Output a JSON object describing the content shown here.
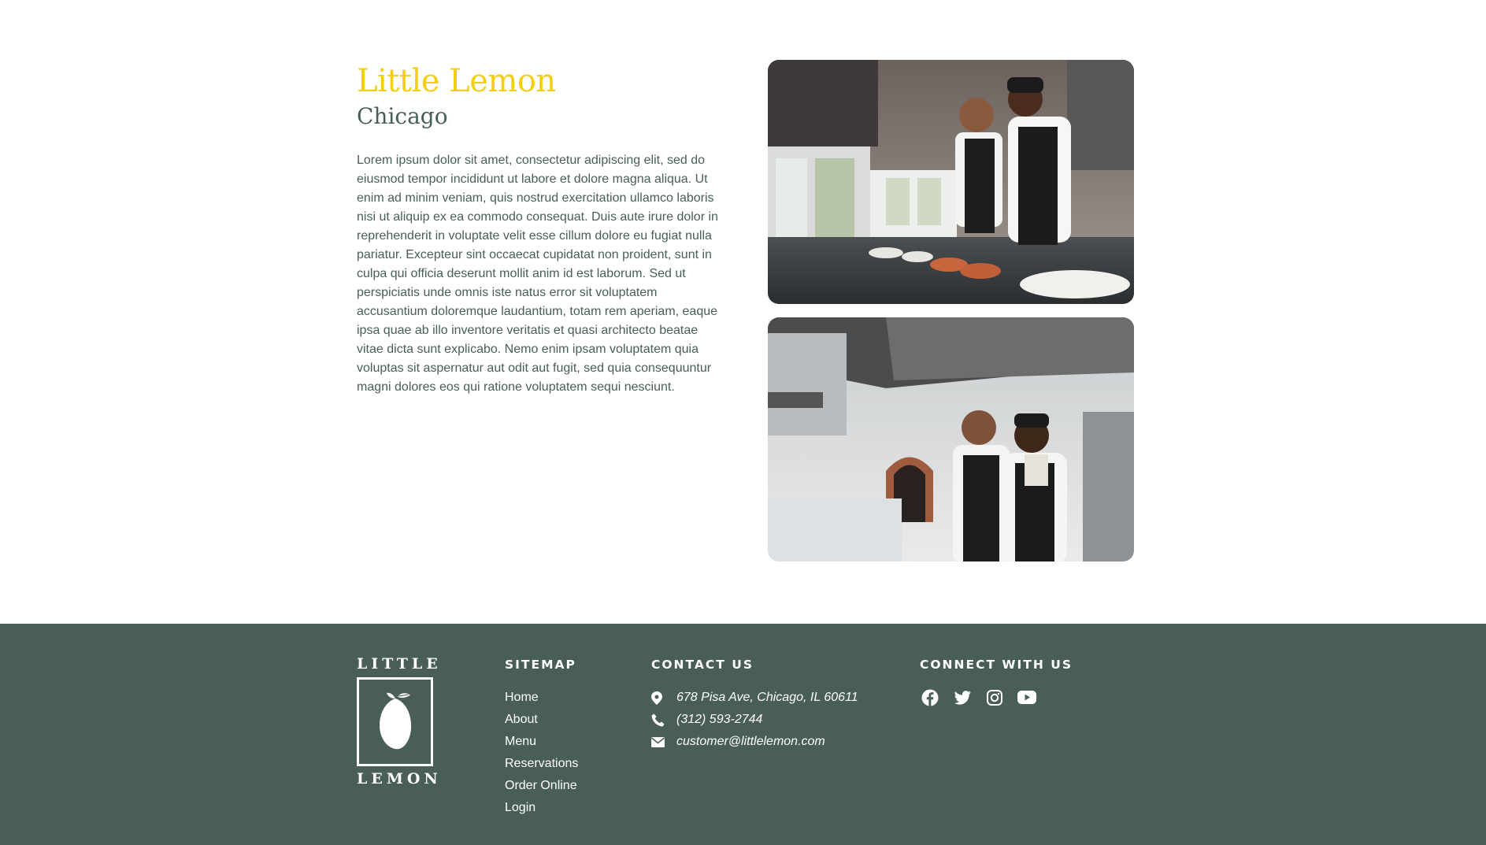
{
  "about": {
    "title": "Little Lemon",
    "subtitle": "Chicago",
    "description": "Lorem ipsum dolor sit amet, consectetur adipiscing elit, sed do eiusmod tempor incididunt ut labore et dolore magna aliqua. Ut enim ad minim veniam, quis nostrud exercitation ullamco laboris nisi ut aliquip ex ea commodo consequat. Duis aute irure dolor in reprehenderit in voluptate velit esse cillum dolore eu fugiat nulla pariatur. Excepteur sint occaecat cupidatat non proident, sunt in culpa qui officia deserunt mollit anim id est laborum. Sed ut perspiciatis unde omnis iste natus error sit voluptatem accusantium doloremque laudantium, totam rem aperiam, eaque ipsa quae ab illo inventore veritatis et quasi architecto beatae vitae dicta sunt explicabo. Nemo enim ipsam voluptatem quia voluptas sit aspernatur aut odit aut fugit, sed quia consequuntur magni dolores eos qui ratione voluptatem sequi nesciunt."
  },
  "colors": {
    "primary_green": "#495e57",
    "primary_yellow": "#f4ce14",
    "white": "#ffffff"
  },
  "footer": {
    "logo": {
      "top_word": "LITTLE",
      "bottom_word": "LEMON",
      "icon": "lemon-icon"
    },
    "sitemap": {
      "heading": "SITEMAP",
      "items": [
        "Home",
        "About",
        "Menu",
        "Reservations",
        "Order Online",
        "Login"
      ]
    },
    "contact": {
      "heading": "CONTACT US",
      "address": "678 Pisa Ave, Chicago, IL 60611",
      "phone": "(312) 593-2744",
      "email": "customer@littlelemon.com",
      "icons": [
        "location-pin-icon",
        "phone-icon",
        "envelope-icon"
      ]
    },
    "connect": {
      "heading": "CONNECT WITH US",
      "icons": [
        "facebook-icon",
        "twitter-icon",
        "instagram-icon",
        "youtube-icon"
      ]
    }
  }
}
